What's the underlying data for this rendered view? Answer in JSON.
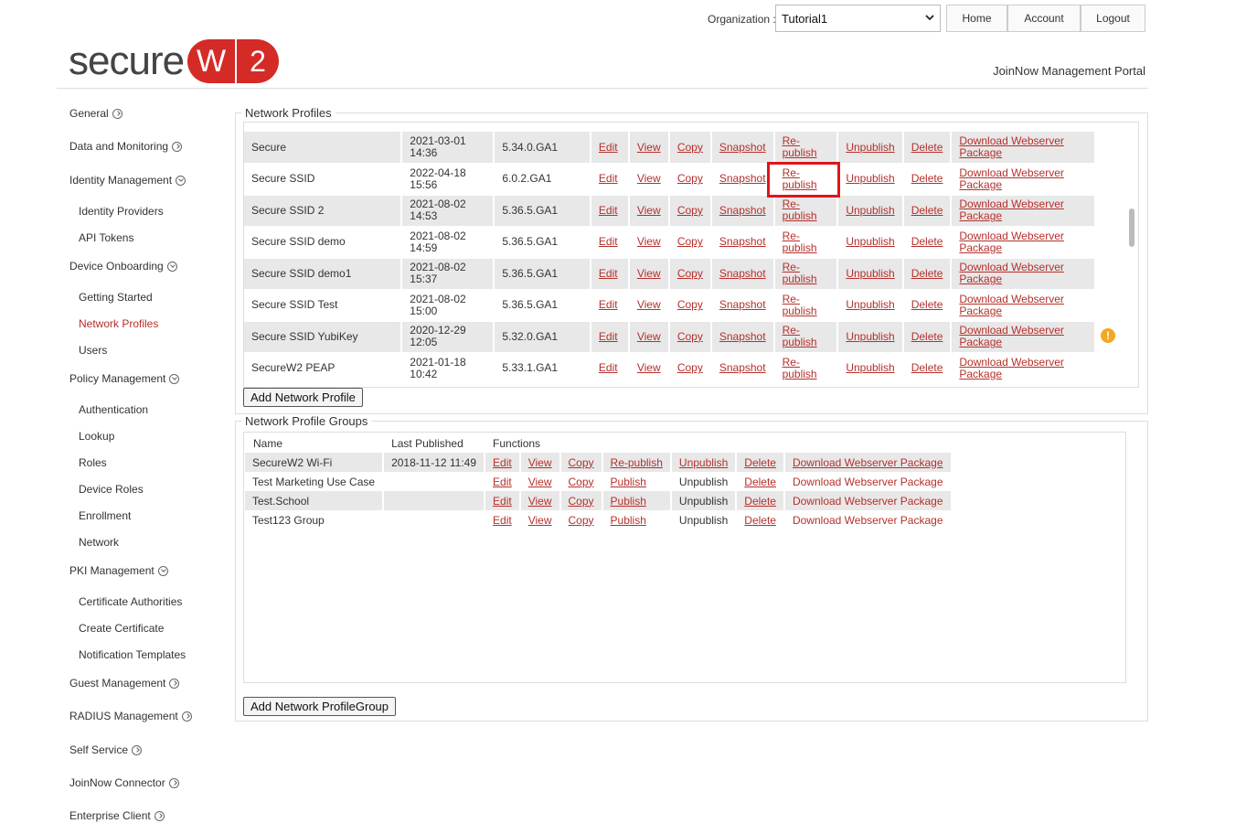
{
  "header": {
    "org_label": "Organization :",
    "org_value": "Tutorial1",
    "nav": [
      "Home",
      "Account",
      "Logout"
    ],
    "logo_text": "secure",
    "logo_w": "W",
    "logo_2": "2",
    "portal_title": "JoinNow Management Portal"
  },
  "sidebar": {
    "general": "General",
    "data_monitoring": "Data and Monitoring",
    "identity_mgmt": "Identity Management",
    "identity_providers": "Identity Providers",
    "api_tokens": "API Tokens",
    "device_onboarding": "Device Onboarding",
    "getting_started": "Getting Started",
    "network_profiles": "Network Profiles",
    "users": "Users",
    "policy_mgmt": "Policy Management",
    "authentication": "Authentication",
    "lookup": "Lookup",
    "roles": "Roles",
    "device_roles": "Device Roles",
    "enrollment": "Enrollment",
    "network": "Network",
    "pki_mgmt": "PKI Management",
    "certificate_authorities": "Certificate Authorities",
    "create_certificate": "Create Certificate",
    "notification_templates": "Notification Templates",
    "guest_mgmt": "Guest Management",
    "radius_mgmt": "RADIUS Management",
    "self_service": "Self Service",
    "joinnow_connector": "JoinNow Connector",
    "enterprise_client": "Enterprise Client"
  },
  "profiles": {
    "legend": "Network Profiles",
    "actions": {
      "edit": "Edit",
      "view": "View",
      "copy": "Copy",
      "snapshot": "Snapshot",
      "republish_1": "Re-",
      "republish_2": "publish",
      "unpublish": "Unpublish",
      "delete": "Delete",
      "download_1": "Download Webserver",
      "download_2": "Package"
    },
    "rows": [
      {
        "name": "Secure",
        "date": "2021-03-01",
        "time": "14:36",
        "version": "5.34.0.GA1"
      },
      {
        "name": "Secure SSID",
        "date": "2022-04-18",
        "time": "15:56",
        "version": "6.0.2.GA1"
      },
      {
        "name": "Secure SSID 2",
        "date": "2021-08-02",
        "time": "14:53",
        "version": "5.36.5.GA1"
      },
      {
        "name": "Secure SSID demo",
        "date": "2021-08-02",
        "time": "14:59",
        "version": "5.36.5.GA1"
      },
      {
        "name": "Secure SSID demo1",
        "date": "2021-08-02",
        "time": "15:37",
        "version": "5.36.5.GA1"
      },
      {
        "name": "Secure SSID Test",
        "date": "2021-08-02",
        "time": "15:00",
        "version": "5.36.5.GA1"
      },
      {
        "name": "Secure SSID YubiKey",
        "date": "2020-12-29",
        "time": "12:05",
        "version": "5.32.0.GA1"
      },
      {
        "name": "SecureW2 PEAP",
        "date": "2021-01-18",
        "time": "10:42",
        "version": "5.33.1.GA1"
      }
    ],
    "add_button": "Add Network Profile",
    "warning_glyph": "!"
  },
  "groups": {
    "legend": "Network Profile Groups",
    "headers": [
      "Name",
      "Last Published",
      "Functions"
    ],
    "rows": [
      {
        "name": "SecureW2 Wi-Fi",
        "published": "2018-11-12 11:49",
        "edit": "Edit",
        "view": "View",
        "copy": "Copy",
        "publish": "Re-publish",
        "unpublish": "Unpublish",
        "delete": "Delete",
        "download": "Download Webserver Package"
      },
      {
        "name": "Test Marketing Use Case",
        "published": "",
        "edit": "Edit",
        "view": "View",
        "copy": "Copy",
        "publish": "Publish",
        "unpublish": "Unpublish",
        "delete": "Delete",
        "download": "Download Webserver Package"
      },
      {
        "name": "Test.School",
        "published": "",
        "edit": "Edit",
        "view": "View",
        "copy": "Copy",
        "publish": "Publish",
        "unpublish": "Unpublish",
        "delete": "Delete",
        "download": "Download Webserver Package"
      },
      {
        "name": "Test123 Group",
        "published": "",
        "edit": "Edit",
        "view": "View",
        "copy": "Copy",
        "publish": "Publish",
        "unpublish": "Unpublish",
        "delete": "Delete",
        "download": "Download Webserver Package"
      }
    ],
    "add_button": "Add Network ProfileGroup"
  },
  "colors": {
    "accent": "#b5302b",
    "logo_red": "#d52b27",
    "highlight": "#e0141a",
    "warning": "#f5a623"
  }
}
